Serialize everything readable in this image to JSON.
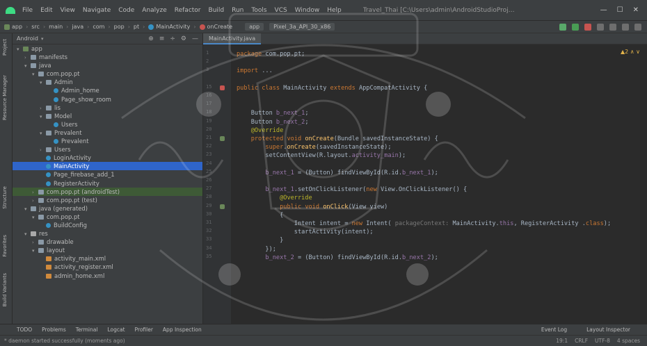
{
  "menubar": {
    "items": [
      "File",
      "Edit",
      "View",
      "Navigate",
      "Code",
      "Analyze",
      "Refactor",
      "Build",
      "Run",
      "Tools",
      "VCS",
      "Window",
      "Help"
    ],
    "window_title": "Travel_Thai [C:\\Users\\admin\\AndroidStudioProjects\\Travel_Thai] - MainActivity.java [app]"
  },
  "navbar": {
    "breadcrumbs": [
      "app",
      "src",
      "main",
      "java",
      "com",
      "pop",
      "pt",
      "MainActivity",
      "onCreate"
    ],
    "run_config": "app",
    "device": "Pixel_3a_API_30_x86"
  },
  "left_strip": {
    "tabs": [
      "Project",
      "Resource Manager",
      "Structure",
      "Favorites",
      "Build Variants"
    ]
  },
  "project": {
    "view_label": "Android",
    "tree": [
      {
        "depth": 0,
        "label": "app",
        "icon": "app",
        "expanded": true
      },
      {
        "depth": 1,
        "label": "manifests",
        "icon": "folder",
        "expanded": false
      },
      {
        "depth": 1,
        "label": "java",
        "icon": "folder",
        "expanded": true
      },
      {
        "depth": 2,
        "label": "com.pop.pt",
        "icon": "pkg",
        "expanded": true
      },
      {
        "depth": 3,
        "label": "Admin",
        "icon": "pkg",
        "expanded": true
      },
      {
        "depth": 4,
        "label": "Admin_home",
        "icon": "cls"
      },
      {
        "depth": 4,
        "label": "Page_show_room",
        "icon": "cls"
      },
      {
        "depth": 3,
        "label": "lis",
        "icon": "pkg",
        "expanded": false
      },
      {
        "depth": 3,
        "label": "Model",
        "icon": "pkg",
        "expanded": true
      },
      {
        "depth": 4,
        "label": "Users",
        "icon": "cls"
      },
      {
        "depth": 3,
        "label": "Prevalent",
        "icon": "pkg",
        "expanded": true
      },
      {
        "depth": 4,
        "label": "Prevalent",
        "icon": "cls"
      },
      {
        "depth": 3,
        "label": "Users",
        "icon": "pkg",
        "expanded": false
      },
      {
        "depth": 3,
        "label": "LoginActivity",
        "icon": "cls"
      },
      {
        "depth": 3,
        "label": "MainActivity",
        "icon": "cls",
        "selected": true
      },
      {
        "depth": 3,
        "label": "Page_firebase_add_1",
        "icon": "cls"
      },
      {
        "depth": 3,
        "label": "RegisterActivity",
        "icon": "cls"
      },
      {
        "depth": 2,
        "label": "com.pop.pt (androidTest)",
        "icon": "pkg",
        "expanded": false,
        "green": true
      },
      {
        "depth": 2,
        "label": "com.pop.pt (test)",
        "icon": "pkg",
        "expanded": false
      },
      {
        "depth": 1,
        "label": "java (generated)",
        "icon": "folder",
        "expanded": true
      },
      {
        "depth": 2,
        "label": "com.pop.pt",
        "icon": "pkg",
        "expanded": true
      },
      {
        "depth": 3,
        "label": "BuildConfig",
        "icon": "cls"
      },
      {
        "depth": 1,
        "label": "res",
        "icon": "res",
        "expanded": true
      },
      {
        "depth": 2,
        "label": "drawable",
        "icon": "folder",
        "expanded": false
      },
      {
        "depth": 2,
        "label": "layout",
        "icon": "folder",
        "expanded": true
      },
      {
        "depth": 3,
        "label": "activity_main.xml",
        "icon": "xml"
      },
      {
        "depth": 3,
        "label": "activity_register.xml",
        "icon": "xml"
      },
      {
        "depth": 3,
        "label": "admin_home.xml",
        "icon": "xml"
      }
    ]
  },
  "editor": {
    "active_tab": "MainActivity.java",
    "inspections": "▲2 ∧ ∨",
    "lines": [
      "package com.pop.pt;",
      "",
      "import ...",
      "",
      "public class MainActivity extends AppCompatActivity {",
      "",
      "",
      "    Button b_next_1;",
      "    Button b_next_2;",
      "    @Override",
      "    protected void onCreate(Bundle savedInstanceState) {",
      "        super.onCreate(savedInstanceState);",
      "        setContentView(R.layout.activity_main);",
      "",
      "        b_next_1 = (Button) findViewById(R.id.b_next_1);",
      "",
      "        b_next_1.setOnClickListener(new View.OnClickListener() {",
      "            @Override",
      "            public void onClick(View view)",
      "            {",
      "                Intent intent = new Intent( packageContext: MainActivity.this, RegisterActivity .class);",
      "                startActivity(intent);",
      "            }",
      "        });",
      "        b_next_2 = (Button) findViewById(R.id.b_next_2);"
    ],
    "line_numbers": [
      "1",
      "2",
      "3",
      "",
      "15",
      "16",
      "17",
      "18",
      "19",
      "20",
      "21",
      "22",
      "23",
      "24",
      "25",
      "26",
      "27",
      "28",
      "29",
      "30",
      "31",
      "32",
      "33",
      "34",
      "35"
    ]
  },
  "bottom_bar": {
    "tools": [
      "TODO",
      "Problems",
      "Terminal",
      "Logcat",
      "Profiler",
      "App Inspection"
    ],
    "right_tools": [
      "Event Log",
      "Layout Inspector"
    ]
  },
  "status_bar": {
    "message": "* daemon started successfully (moments ago)",
    "position": "19:1",
    "line_sep": "CRLF",
    "encoding": "UTF-8",
    "indent": "4 spaces"
  },
  "colors": {
    "bg": "#2b2b2b",
    "panel": "#3c3f41",
    "keyword": "#cc7832",
    "annotation": "#bbb529",
    "field": "#9876aa",
    "function": "#ffc66d",
    "selection": "#2f65ca",
    "watermark": "#ffffff"
  }
}
